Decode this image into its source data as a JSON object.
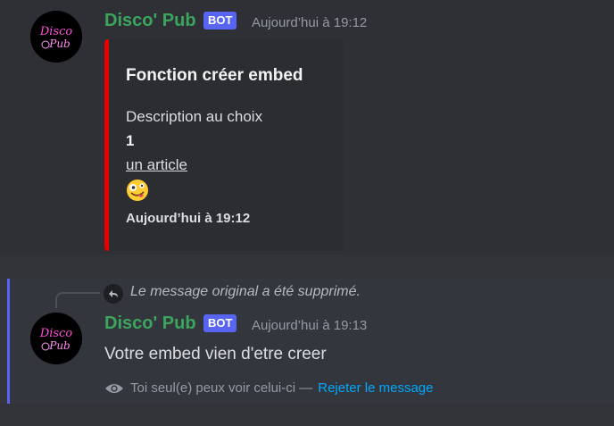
{
  "messages": [
    {
      "username": "Disco' Pub",
      "bot_tag": "BOT",
      "timestamp": "Aujourd’hui à 19:12",
      "avatar_text": [
        "Disco",
        "Pub"
      ],
      "embed": {
        "color": "#e60000",
        "title": "Fonction créer embed",
        "description_line": "Description au choix",
        "bold_line": "1",
        "link_text": "un article",
        "emoji": "zany-face",
        "footer": "Aujourd’hui à 19:12"
      }
    },
    {
      "username": "Disco' Pub",
      "bot_tag": "BOT",
      "timestamp": "Aujourd’hui à 19:13",
      "avatar_text": [
        "Disco",
        "Pub"
      ],
      "reply_text": "Le message original a été supprimé.",
      "content": "Votre embed vien d'etre creer",
      "ephemeral_note": "Toi seul(e) peux voir celui-ci —",
      "dismiss_label": "Rejeter le message"
    }
  ],
  "colors": {
    "username": "#3ba55d",
    "bot_tag": "#5865f2",
    "link": "#00a8fc",
    "background": "#313338"
  }
}
